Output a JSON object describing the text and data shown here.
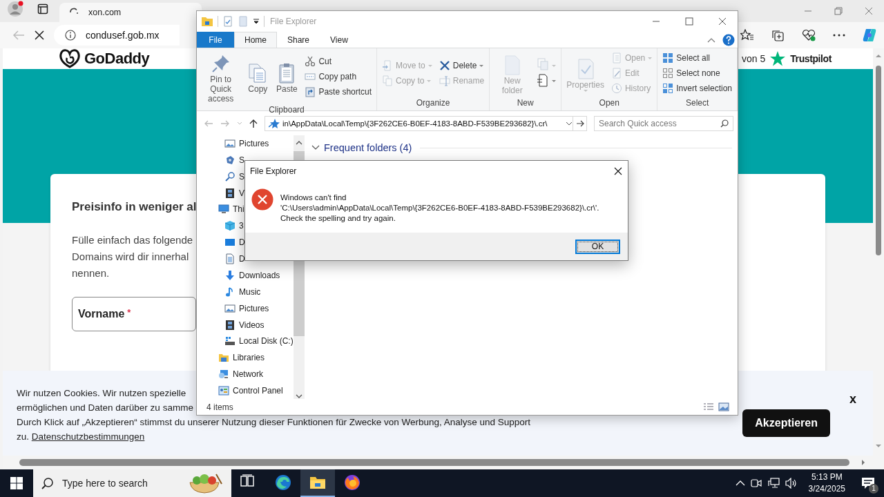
{
  "browser": {
    "tab": {
      "title": "xon.com"
    },
    "address": "condusef.gob.mx",
    "page": {
      "logo": "GoDaddy",
      "rating": {
        "text": "von 5",
        "brand": "Trustpilot"
      },
      "card": {
        "heading": "Preisinfo in weniger al",
        "paragraph": "Fülle einfach das folgende\nDomains wird dir innerhal\nnennen.",
        "field": {
          "label": "Vorname",
          "required_mark": "*"
        }
      },
      "cookie_banner": {
        "text": "Wir nutzen Cookies. Wir nutzen spezielle\nermöglichen und Daten darüber zu samme\nDurch Klick auf „Akzeptieren“ stimmst du unserer Nutzung dieser Funktionen für Zwecke von Werbung, Analyse und Support\nzu. ",
        "link": "Datenschutzbestimmungen",
        "accept_button": "Akzeptieren",
        "close": "x"
      }
    }
  },
  "explorer": {
    "title": "File Explorer",
    "file_tab": "File",
    "tabs": [
      {
        "label": "Home",
        "selected": true
      },
      {
        "label": "Share",
        "selected": false
      },
      {
        "label": "View",
        "selected": false
      }
    ],
    "ribbon": [
      {
        "label": "Clipboard",
        "columns": [
          [
            {
              "label": "Pin to Quick access",
              "kind": "large",
              "disabled": false
            }
          ],
          [
            {
              "label": "Copy",
              "kind": "large",
              "disabled": false
            }
          ],
          [
            {
              "label": "Paste",
              "kind": "large",
              "disabled": false
            }
          ],
          [
            {
              "label": "Cut",
              "kind": "small",
              "disabled": false
            },
            {
              "label": "Copy path",
              "kind": "small",
              "disabled": false
            },
            {
              "label": "Paste shortcut",
              "kind": "small",
              "disabled": false
            }
          ]
        ]
      },
      {
        "label": "Organize",
        "columns": [
          [
            {
              "label": "Move to",
              "kind": "small",
              "disabled": true,
              "menu": true
            },
            {
              "label": "Copy to",
              "kind": "small",
              "disabled": true,
              "menu": true
            }
          ],
          [
            {
              "label": "Delete",
              "kind": "small",
              "disabled": false,
              "menu": true
            },
            {
              "label": "Rename",
              "kind": "small",
              "disabled": true
            }
          ]
        ]
      },
      {
        "label": "New",
        "columns": [
          [
            {
              "label": "New folder",
              "kind": "large",
              "disabled": true
            }
          ],
          [
            {
              "kind": "icon",
              "disabled": true,
              "menu": true
            },
            {
              "kind": "icon",
              "disabled": false,
              "menu": true
            }
          ]
        ]
      },
      {
        "label": "Open",
        "columns": [
          [
            {
              "label": "Properties",
              "kind": "large",
              "disabled": true,
              "menu": true
            }
          ],
          [
            {
              "label": "Open",
              "kind": "small",
              "disabled": true,
              "menu": true
            },
            {
              "label": "Edit",
              "kind": "small",
              "disabled": true
            },
            {
              "label": "History",
              "kind": "small",
              "disabled": true
            }
          ]
        ]
      },
      {
        "label": "Select",
        "columns": [
          [
            {
              "label": "Select all",
              "kind": "small",
              "disabled": false
            },
            {
              "label": "Select none",
              "kind": "small",
              "disabled": false
            },
            {
              "label": "Invert selection",
              "kind": "small",
              "disabled": false
            }
          ]
        ]
      }
    ],
    "address": "in\\AppData\\Local\\Temp\\{3F262CE6-B0EF-4183-8ABD-F539BE293682}\\.cr\\",
    "search_placeholder": "Search Quick access",
    "quick_access_items": [
      "Pictures",
      "S",
      "S",
      "V"
    ],
    "tree": [
      {
        "label": "Thi",
        "children": [
          {
            "label": "3"
          },
          {
            "label": "D"
          },
          {
            "label": "D"
          },
          {
            "label": "Downloads"
          },
          {
            "label": "Music"
          },
          {
            "label": "Pictures"
          },
          {
            "label": "Videos"
          },
          {
            "label": "Local Disk (C:)"
          }
        ]
      },
      {
        "label": "Libraries"
      },
      {
        "label": "Network"
      },
      {
        "label": "Control Panel"
      }
    ],
    "group": {
      "label": "Frequent folders (4)",
      "expanded": true
    },
    "status": "4 items"
  },
  "dialog": {
    "title": "File Explorer",
    "message": "Windows can't find\n'C:\\Users\\admin\\AppData\\Local\\Temp\\{3F262CE6-B0EF-4183-8ABD-F539BE293682}\\.cr\\'.\nCheck the spelling and try again.",
    "button": "OK"
  },
  "taskbar": {
    "search_placeholder": "Type here to search",
    "apps": [
      {
        "kind": "taskview",
        "selected": false
      },
      {
        "kind": "swirl",
        "selected": false
      },
      {
        "kind": "folder",
        "selected": true
      },
      {
        "kind": "fox",
        "selected": false
      }
    ],
    "time": "5:13 PM",
    "date": "3/24/2025",
    "notifications": "1"
  }
}
